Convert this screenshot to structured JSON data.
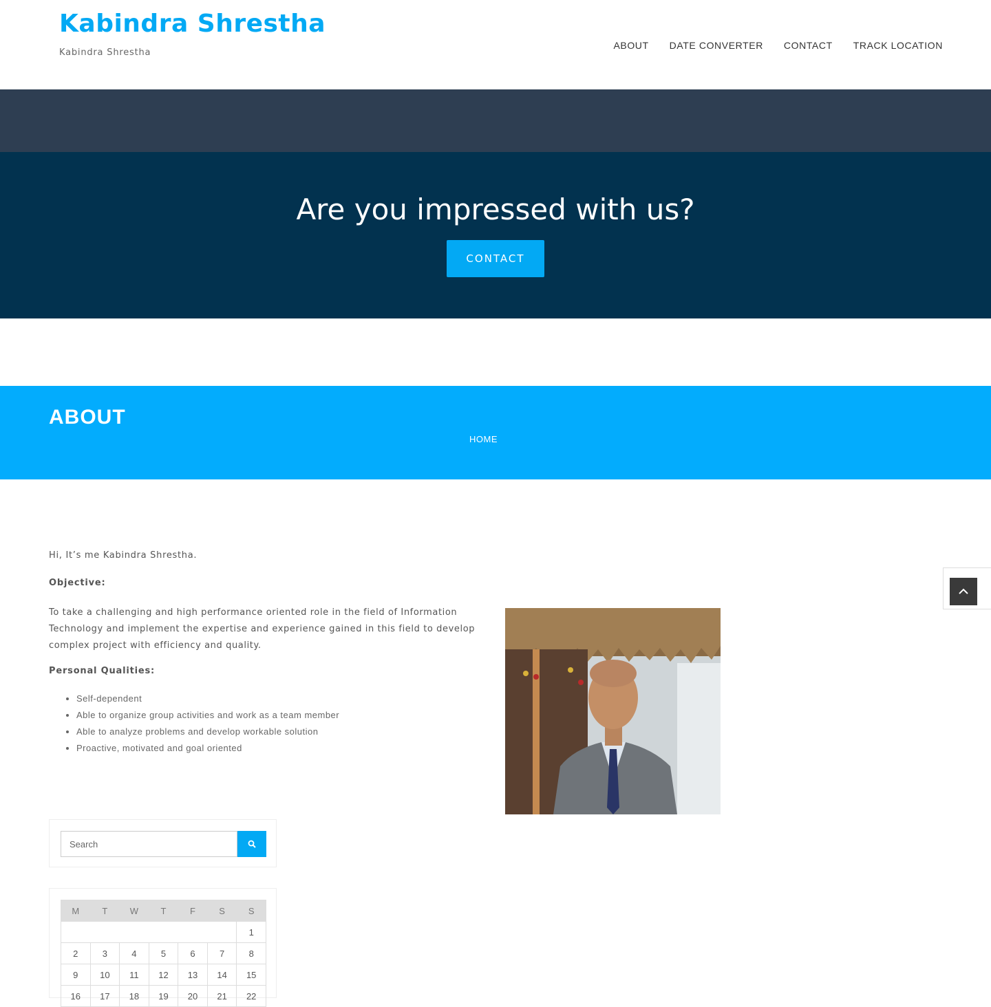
{
  "header": {
    "title": "Kabindra Shrestha",
    "tagline": "Kabindra Shrestha",
    "nav": [
      "ABOUT",
      "DATE CONVERTER",
      "CONTACT",
      "TRACK LOCATION"
    ]
  },
  "cta": {
    "heading": "Are you impressed with us?",
    "button": "CONTACT"
  },
  "banner": {
    "title": "ABOUT",
    "breadcrumb": "HOME"
  },
  "content": {
    "intro": "Hi, It’s me Kabindra Shrestha.",
    "objective_heading": "Objective:",
    "objective_text": "To take a challenging and high performance oriented role in the field of Information Technology and implement the expertise and experience gained in this field to develop complex project with efficiency and quality.",
    "qualities_heading": "Personal Qualities:",
    "qualities": [
      "Self-dependent",
      "Able to organize group activities and work as a team member",
      "Able to analyze problems and develop workable solution",
      "Proactive, motivated and goal oriented"
    ]
  },
  "sidebar": {
    "search_placeholder": "Search",
    "search_icon": "search-icon",
    "calendar": {
      "days": [
        "M",
        "T",
        "W",
        "T",
        "F",
        "S",
        "S"
      ],
      "weeks": [
        [
          "",
          "",
          "",
          "",
          "",
          "",
          "1"
        ],
        [
          "2",
          "3",
          "4",
          "5",
          "6",
          "7",
          "8"
        ],
        [
          "9",
          "10",
          "11",
          "12",
          "13",
          "14",
          "15"
        ],
        [
          "16",
          "17",
          "18",
          "19",
          "20",
          "21",
          "22"
        ]
      ]
    }
  },
  "colors": {
    "accent": "#03a9f4",
    "navy": "#02324f",
    "slate": "#2e3e52"
  },
  "back_to_top_icon": "chevron-up-icon"
}
